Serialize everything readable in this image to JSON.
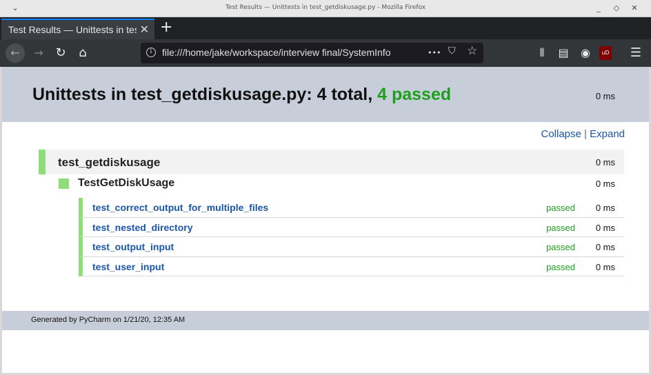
{
  "window": {
    "title": "Test Results — Unittests in test_getdiskusage.py - Mozilla Firefox",
    "menu_glyph": "⌄",
    "minimize_glyph": "_",
    "restore_glyph": "◇",
    "close_glyph": "✕"
  },
  "tabs": [
    {
      "label": "Test Results — Unittests in test_getdiskusage.py",
      "close_glyph": "✕"
    }
  ],
  "newtab_glyph": "+",
  "toolbar": {
    "back_glyph": "←",
    "forward_glyph": "→",
    "reload_glyph": "↻",
    "home_glyph": "⌂",
    "info_glyph": "i",
    "url": "file:///home/jake/workspace/interview final/SystemInfo",
    "more_glyph": "•••",
    "pocket_glyph": "⛉",
    "star_glyph": "☆",
    "library_glyph": "⫴",
    "sidebar_glyph": "▤",
    "account_glyph": "◉",
    "ublock_glyph": "uD",
    "menu_glyph": "☰"
  },
  "report": {
    "heading_prefix": "Unittests in test_getdiskusage.py: 4 total,",
    "heading_passed": "4 passed",
    "total_duration": "0 ms",
    "collapse_label": "Collapse",
    "separator": "|",
    "expand_label": "Expand",
    "suite": {
      "name": "test_getdiskusage",
      "duration": "0 ms",
      "class": {
        "name": "TestGetDiskUsage",
        "duration": "0 ms",
        "tests": [
          {
            "name": "test_correct_output_for_multiple_files",
            "status": "passed",
            "duration": "0 ms"
          },
          {
            "name": "test_nested_directory",
            "status": "passed",
            "duration": "0 ms"
          },
          {
            "name": "test_output_input",
            "status": "passed",
            "duration": "0 ms"
          },
          {
            "name": "test_user_input",
            "status": "passed",
            "duration": "0 ms"
          }
        ]
      }
    },
    "footer": "Generated by PyCharm on 1/21/20, 12:35 AM"
  },
  "colors": {
    "pass_green": "#1ea01e",
    "pass_bar": "#8fdc7a",
    "link_blue": "#1a56a8",
    "header_bg": "#c8ced9"
  }
}
